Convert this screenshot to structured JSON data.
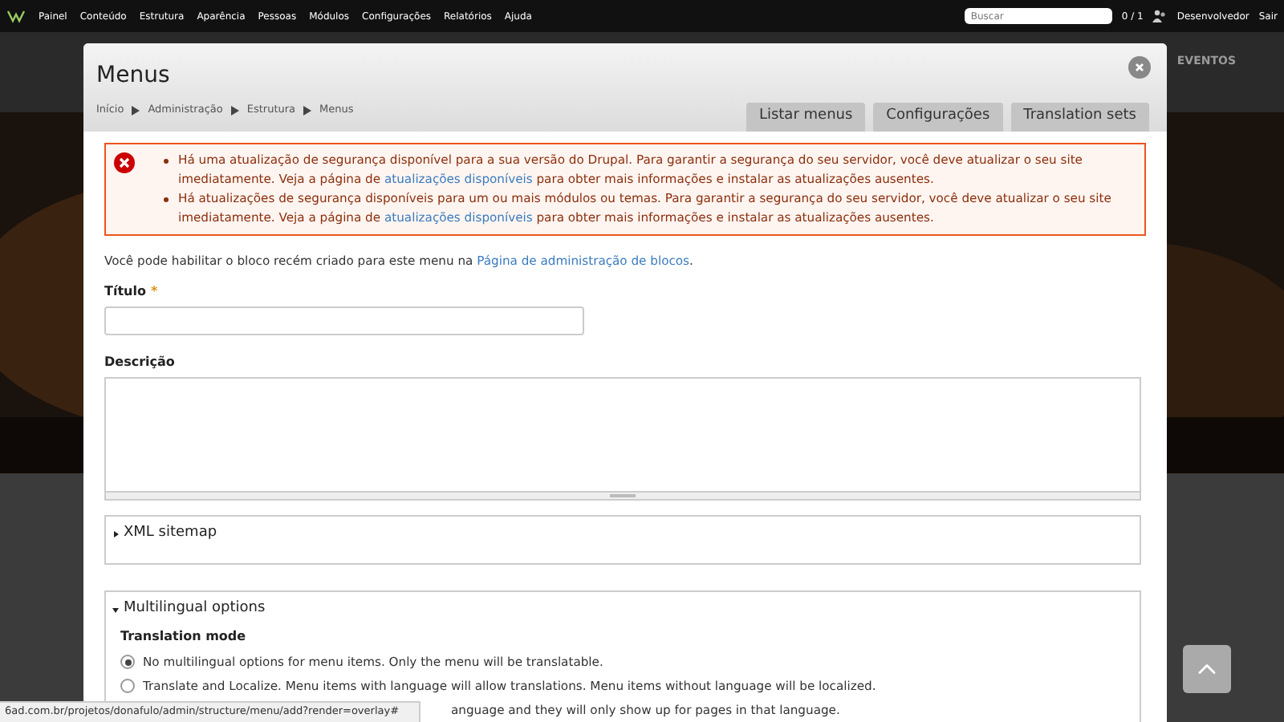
{
  "toolbar": {
    "menu": [
      "Painel",
      "Conteúdo",
      "Estrutura",
      "Aparência",
      "Pessoas",
      "Módulos",
      "Configurações",
      "Relatórios",
      "Ajuda"
    ],
    "search": {
      "placeholder": "Buscar"
    },
    "counter": "0 / 1",
    "user": "Desenvolvedor",
    "logout": "Sair"
  },
  "background": {
    "nav_item": "EVENTOS"
  },
  "dialog": {
    "title": "Menus",
    "breadcrumb": [
      "Início",
      "Administração",
      "Estrutura",
      "Menus"
    ],
    "tabs": [
      {
        "label": "Listar menus",
        "selected": false
      },
      {
        "label": "Configurações",
        "selected": false
      },
      {
        "label": "Translation sets",
        "selected": false
      }
    ],
    "errors": [
      {
        "text": "Há uma atualização de segurança disponível para a sua versão do Drupal. Para garantir a segurança do seu servidor, você deve atualizar o seu site imediatamente. Veja a página de",
        "link": "atualizações disponíveis",
        "after": "para obter mais informações e instalar as atualizações ausentes."
      },
      {
        "text": "Há atualizações de segurança disponíveis para um ou mais módulos ou temas. Para garantir a segurança do seu servidor, você deve atualizar o seu site imediatamente. Veja a página de",
        "link": "atualizações disponíveis",
        "after": "para obter mais informações e instalar as atualizações ausentes."
      }
    ],
    "intro": {
      "text": "Você pode habilitar o bloco recém criado para este menu na",
      "link": "Página de administração de blocos",
      "after": "."
    },
    "title_field": {
      "label": "Título",
      "required_mark": "*"
    },
    "description_field": {
      "label": "Descrição"
    },
    "sections": [
      {
        "title": "XML sitemap",
        "expanded": false
      },
      {
        "title": "Multilingual options",
        "expanded": true,
        "heading": "Translation mode",
        "options": [
          {
            "label": "No multilingual options for menu items. Only the menu will be translatable.",
            "selected": true
          },
          {
            "label": "Translate and Localize. Menu items with language will allow translations. Menu items without language will be localized.",
            "selected": false
          },
          {
            "label": "anguage and they will only show up for pages in that language."
          }
        ]
      }
    ]
  },
  "status_bar": "6ad.com.br/projetos/donafulo/admin/structure/menu/add?render=overlay#"
}
